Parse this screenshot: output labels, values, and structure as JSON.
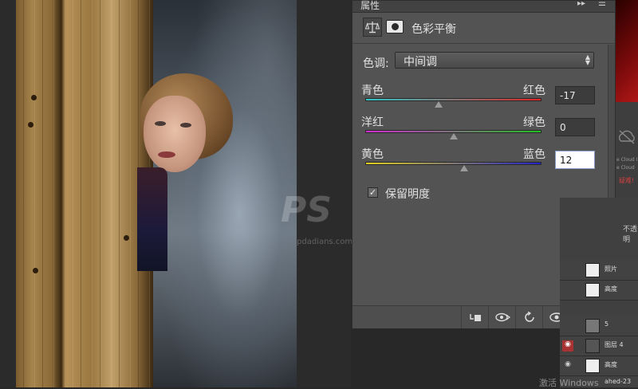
{
  "panel": {
    "title": "属性",
    "section_title": "色彩平衡",
    "tone": {
      "label": "色调:",
      "value": "中间调"
    },
    "sliders": [
      {
        "left_label": "青色",
        "right_label": "红色",
        "value": "-17",
        "fraction": 0.415,
        "gradient": [
          "#2fc6c6",
          "#e02424"
        ]
      },
      {
        "left_label": "洋红",
        "right_label": "绿色",
        "value": "0",
        "fraction": 0.5,
        "gradient": [
          "#d02ad0",
          "#22c022"
        ]
      },
      {
        "left_label": "黄色",
        "right_label": "蓝色",
        "value": "12",
        "fraction": 0.56,
        "gradient": [
          "#e0d020",
          "#2222c8"
        ]
      }
    ],
    "preserve_luminosity": {
      "label": "保留明度",
      "checked": true
    },
    "footer_icons": [
      "clip-to-layer-icon",
      "view-previous-icon",
      "reset-icon",
      "visibility-icon",
      "delete-icon"
    ]
  },
  "canvas": {
    "watermark": "PS",
    "watermark_url": "pdadians.com"
  },
  "right_panel": {
    "cloud_line1": "e Cloud I",
    "cloud_line2": "e Cloud",
    "cloud_error": "疑难!",
    "opacity_label": "不透明",
    "layers": [
      {
        "name": "照片"
      },
      {
        "name": "高度"
      },
      {
        "name": "5"
      },
      {
        "name": "图层 4"
      },
      {
        "name": "高度"
      },
      {
        "name": "ahed-23"
      }
    ]
  },
  "system": {
    "activate_windows": "激活 Windows"
  }
}
